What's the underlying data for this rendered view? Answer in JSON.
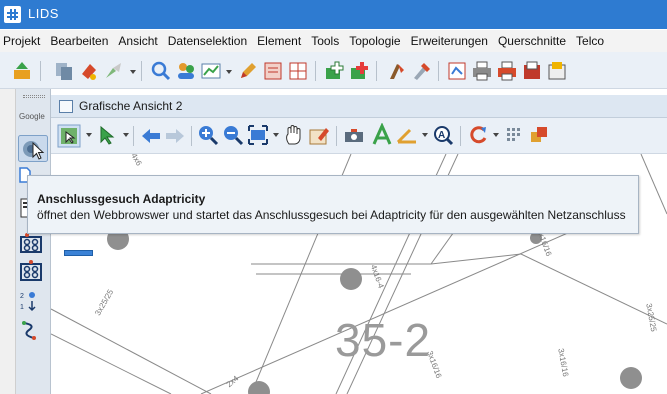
{
  "window": {
    "title": "LIDS"
  },
  "menu": {
    "items": [
      "Projekt",
      "Bearbeiten",
      "Ansicht",
      "Datenselektion",
      "Element",
      "Tools",
      "Topologie",
      "Erweiterungen",
      "Querschnitte",
      "Telco"
    ]
  },
  "left_strip": {
    "google_label": "Google"
  },
  "view": {
    "title": "Grafische Ansicht 2"
  },
  "tooltip": {
    "title": "Anschlussgesuch Adaptricity",
    "description": "öffnet den Webbrowswer und startet das Anschlussgesuch bei Adaptricity für den ausgewählten Netzanschluss"
  },
  "map": {
    "area_label": "35-2",
    "labels": [
      "3x25/25",
      "4x16-4",
      "3x16/16",
      "3x16/16",
      "3x25/25",
      "3x16/16",
      "2x4",
      "4x6"
    ]
  },
  "colors": {
    "titlebar": "#2e7bd1",
    "toolbar_bg": "#eaf0f7",
    "tooltip_bg": "#eef3f8",
    "map_line": "#8a8a8a",
    "node": "#8f8f8f",
    "selection": "#3b82d6"
  }
}
